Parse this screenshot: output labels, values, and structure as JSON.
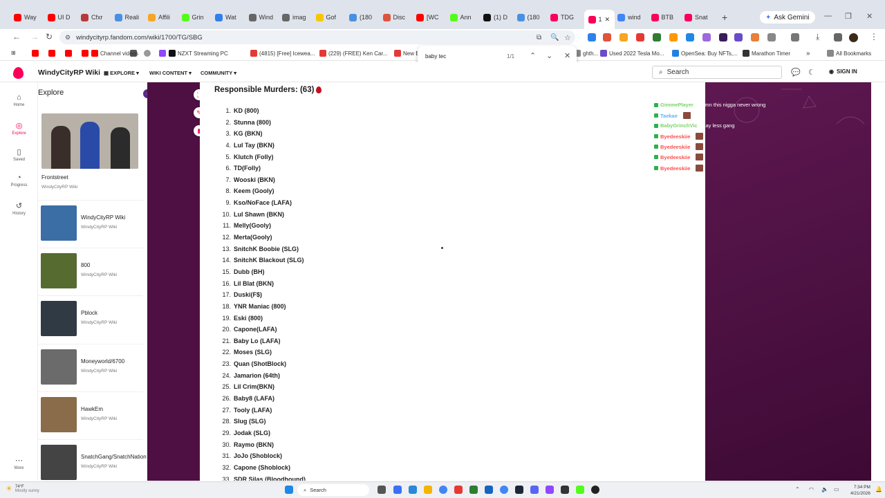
{
  "colors": {
    "fandom_pink": "#fa005a",
    "wiki_purple": "#4e1043",
    "chat_green": "#7bd36a",
    "chat_cyan": "#58b6ff",
    "chat_red": "#ff4d4d"
  },
  "browser": {
    "tabs": [
      {
        "label": "Way",
        "icon": "youtube-icon",
        "color": "#ff0000"
      },
      {
        "label": "UI D",
        "icon": "youtube-icon",
        "color": "#ff0000"
      },
      {
        "label": "Cfxr",
        "icon": "cfx-icon",
        "color": "#b63a3a"
      },
      {
        "label": "Reali",
        "icon": "chrome-icon",
        "color": "#4a90e2"
      },
      {
        "label": "Affili",
        "icon": "affiliate-icon",
        "color": "#f5a623"
      },
      {
        "label": "Grin",
        "icon": "kick-icon",
        "color": "#53fc18"
      },
      {
        "label": "Wat",
        "icon": "edge-icon",
        "color": "#2f80ed"
      },
      {
        "label": "Wind",
        "icon": "globe-icon",
        "color": "#666666"
      },
      {
        "label": "imag",
        "icon": "globe-icon",
        "color": "#666666"
      },
      {
        "label": "Gof",
        "icon": "gofundme-icon",
        "color": "#f7c600"
      },
      {
        "label": "(180",
        "icon": "chrome-icon",
        "color": "#4a90e2"
      },
      {
        "label": "Disc",
        "icon": "discord-icon",
        "color": "#e0533d"
      },
      {
        "label": "[WC",
        "icon": "youtube-icon",
        "color": "#ff0000"
      },
      {
        "label": "Ann",
        "icon": "kick-icon",
        "color": "#53fc18"
      },
      {
        "label": "(1) D",
        "icon": "x-icon",
        "color": "#111111"
      },
      {
        "label": "(180",
        "icon": "chrome-icon",
        "color": "#4a90e2"
      },
      {
        "label": "TDG",
        "icon": "fandom-icon",
        "color": "#fa005a"
      },
      {
        "label": "1",
        "icon": "fandom-icon",
        "color": "#fa005a"
      },
      {
        "label": "wind",
        "icon": "google-icon",
        "color": "#4285f4"
      },
      {
        "label": "BTB",
        "icon": "fandom-icon",
        "color": "#fa005a"
      },
      {
        "label": "Snat",
        "icon": "fandom-icon",
        "color": "#fa005a"
      }
    ],
    "gemini_label": "Ask Gemini",
    "url": "windycityrp.fandom.com/wiki/1700/TG/SBG",
    "bookmarks": [
      {
        "label": "Channel videos",
        "icon": "youtube-icon"
      },
      {
        "label": "NZXT Streaming PC",
        "icon": "nzxt-icon"
      },
      {
        "label": "(4815) [Free] Icewea...",
        "icon": "youtube-icon"
      },
      {
        "label": "(229) (FREE) Ken Car...",
        "icon": "youtube-icon"
      },
      {
        "label": "New B",
        "icon": "tesla-icon"
      },
      {
        "label": "ghth...",
        "icon": "globe-icon"
      },
      {
        "label": "Used 2022 Tesla Mo...",
        "icon": "globe-icon"
      },
      {
        "label": "OpenSea: Buy NFTs,...",
        "icon": "opensea-icon"
      },
      {
        "label": "Marathon Timer",
        "icon": "timer-icon"
      },
      {
        "label": "All Bookmarks",
        "icon": "folder-icon"
      }
    ],
    "find": {
      "query": "baby tec",
      "count": "1/1"
    }
  },
  "wiki": {
    "name": "WindyCityRP Wiki",
    "nav": [
      "EXPLORE",
      "WIKI CONTENT",
      "COMMUNITY"
    ],
    "search_placeholder": "Search",
    "signin": "SIGN IN"
  },
  "rail": [
    {
      "label": "Home",
      "icon": "home-icon"
    },
    {
      "label": "Explore",
      "icon": "compass-icon"
    },
    {
      "label": "Saved",
      "icon": "bookmark-icon"
    },
    {
      "label": "Progress",
      "icon": "progress-icon"
    },
    {
      "label": "History",
      "icon": "history-icon"
    },
    {
      "label": "More",
      "icon": "more-icon"
    }
  ],
  "explore": {
    "title": "Explore",
    "featured": {
      "title": "Frontstreet",
      "sub": "WindyCityRP Wiki"
    },
    "cards": [
      {
        "title": "WindyCityRP Wiki",
        "sub": "WindyCityRP Wiki"
      },
      {
        "title": "800",
        "sub": "WindyCityRP Wiki"
      },
      {
        "title": "Pblock",
        "sub": "WindyCityRP Wiki"
      },
      {
        "title": "Moneyworld/6700",
        "sub": "WindyCityRP Wiki"
      },
      {
        "title": "HawkEm",
        "sub": "WindyCityRP Wiki"
      },
      {
        "title": "SnatchGang/SnatchNation",
        "sub": "WindyCityRP Wiki"
      }
    ]
  },
  "article": {
    "heading": "Responsible Murders: (63)",
    "murders": [
      "KD (800)",
      "Stunna (800)",
      "KG (BKN)",
      "Lul Tay (BKN)",
      "Klutch (Folly)",
      "TD(Folly)",
      "Wooski (BKN)",
      "Keem (Gooly)",
      "Kso/NoFace (LAFA)",
      "Lul Shawn (BKN)",
      "Melly(Gooly)",
      "Merta(Gooly)",
      "SnitchK Boobie (SLG)",
      "SnitchK Blackout (SLG)",
      "Dubb (BH)",
      "Lil Blat (BKN)",
      "Duski(F$)",
      "YNR Maniac (800)",
      "Eski (800)",
      "Capone(LAFA)",
      "Baby Lo (LAFA)",
      "Moses (SLG)",
      "Quan (ShotBlock)",
      "Jamarion (64th)",
      "Lil Crim(BKN)",
      "Baby8 (LAFA)",
      "Tooly (LAFA)",
      "Slug (SLG)",
      "Jodak (SLG)",
      "Raymo (BKN)",
      "JoJo (Shoblock)",
      "Capone (Shoblock)",
      "SDR Silas (Bloodhound)"
    ]
  },
  "chat": [
    {
      "user": "GimmePlayer",
      "msg": "damn this nigga never wrong",
      "color": "#7bd36a",
      "emote": false
    },
    {
      "user": "Taekae",
      "msg": "",
      "color": "#58b6ff",
      "emote": true
    },
    {
      "user": "BabyGrinchVic",
      "msg": "say less gang",
      "color": "#7bd36a",
      "emote": false
    },
    {
      "user": "Byedeeskiie",
      "msg": "",
      "color": "#ff4d4d",
      "emote": true
    },
    {
      "user": "Byedeeskiie",
      "msg": "",
      "color": "#ff4d4d",
      "emote": true
    },
    {
      "user": "Byedeeskiie",
      "msg": "",
      "color": "#ff4d4d",
      "emote": true
    },
    {
      "user": "Byedeeskiie",
      "msg": "",
      "color": "#ff4d4d",
      "emote": true
    }
  ],
  "taskbar": {
    "weather_temp": "74°F",
    "weather_desc": "Mostly sunny",
    "search": "Search",
    "time": "7:34 PM",
    "date": "4/21/2026"
  }
}
